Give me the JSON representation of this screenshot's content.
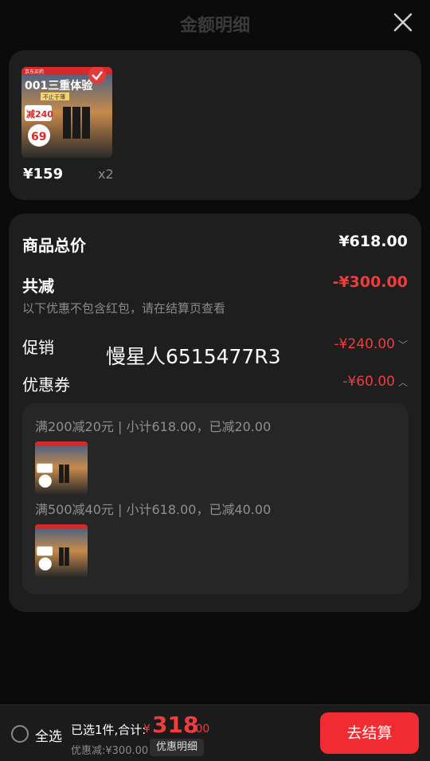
{
  "header": {
    "title": "金额明细"
  },
  "product": {
    "price": "¥159",
    "quantity": "x2",
    "thumb_text": {
      "brand": "京东买药",
      "headline": "001三重体验",
      "tagline": "不止于薄",
      "discount": "减240",
      "final_price": "69"
    }
  },
  "summary": {
    "total_label": "商品总价",
    "total_value": "¥618.00",
    "reduce_label": "共减",
    "reduce_value": "-¥300.00",
    "reduce_note": "以下优惠不包含红包，请在结算页查看",
    "promo_label": "促销",
    "promo_value": "-¥240.00",
    "coupon_label": "优惠券",
    "coupon_value": "-¥60.00",
    "watermark": "慢星人6515477R3"
  },
  "coupons": [
    {
      "text": "满200减20元 | 小计618.00，已减20.00"
    },
    {
      "text": "满500减40元 | 小计618.00，已减40.00"
    }
  ],
  "footer": {
    "select_all": "全选",
    "selected_text": "已选1件,合计:",
    "currency": "¥",
    "total_int": "318",
    "total_dec": ".00",
    "discount_text": "优惠减:¥300.00",
    "detail_button": "优惠明细",
    "checkout_button": "去结算"
  },
  "colors": {
    "accent": "#f23c3c",
    "checkout": "#f02c32",
    "card": "#1e1e1e",
    "background": "#0b0b0b"
  }
}
